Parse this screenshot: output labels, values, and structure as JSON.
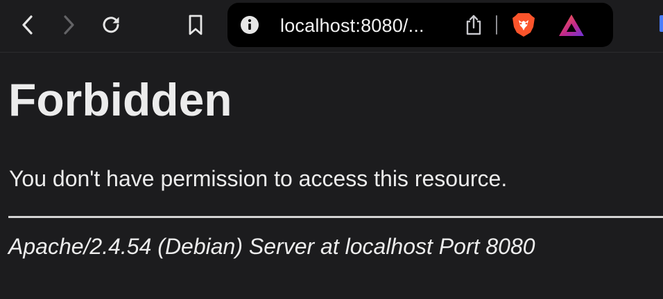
{
  "browser": {
    "url_display": "localhost:8080/...",
    "accent_color": "#4a7dff",
    "icons": {
      "back": "chevron-left-icon",
      "forward": "chevron-right-icon",
      "reload": "reload-icon",
      "bookmark": "bookmark-icon",
      "site_info": "info-icon",
      "share": "share-icon",
      "brave_shields": "brave-lion-icon",
      "brave_rewards": "brave-rewards-triangle-icon"
    }
  },
  "page": {
    "title": "Forbidden",
    "message": "You don't have permission to access this resource.",
    "signature": "Apache/2.4.54 (Debian) Server at localhost Port 8080"
  }
}
